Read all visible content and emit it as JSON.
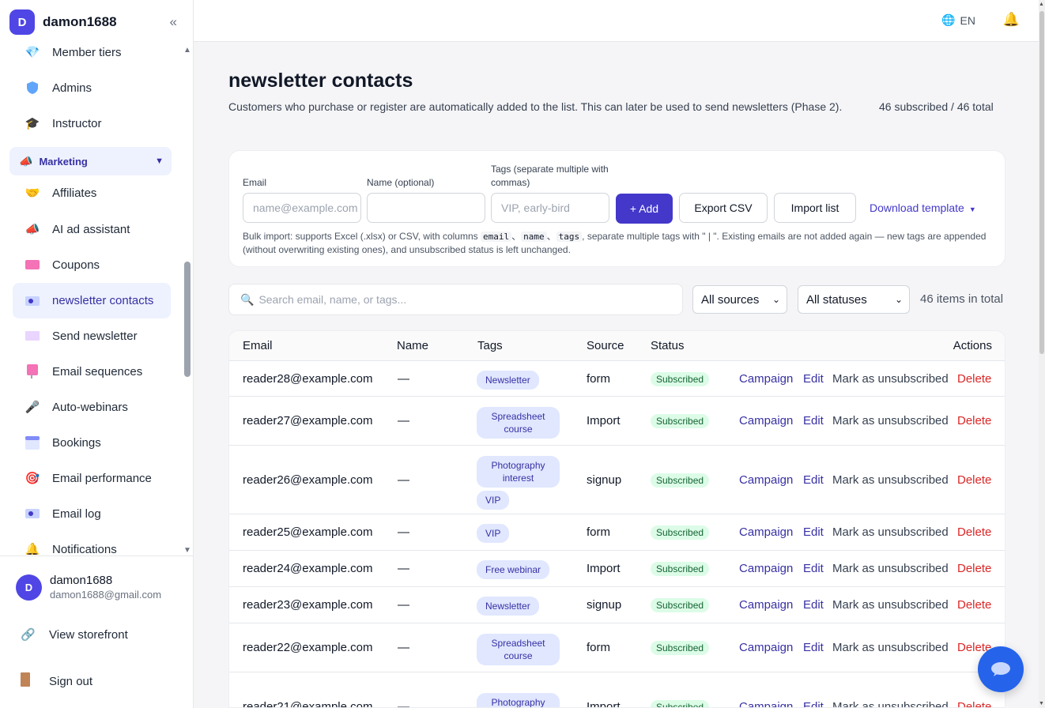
{
  "brand": {
    "initial": "D",
    "name": "damon1688"
  },
  "sidebar": {
    "items": [
      {
        "label": "Member tiers",
        "icon": "diamond-icon"
      },
      {
        "label": "Admins",
        "icon": "shield-icon"
      },
      {
        "label": "Instructor",
        "icon": "graduation-cap-icon"
      },
      {
        "label": "Marketing",
        "icon": "megaphone-icon"
      },
      {
        "label": "Affiliates",
        "icon": "handshake-icon"
      },
      {
        "label": "AI ad assistant",
        "icon": "megaphone-icon"
      },
      {
        "label": "Coupons",
        "icon": "ticket-icon"
      },
      {
        "label": "newsletter contacts",
        "icon": "contact-card-icon"
      },
      {
        "label": "Send newsletter",
        "icon": "envelope-icon"
      },
      {
        "label": "Email sequences",
        "icon": "sequence-icon"
      },
      {
        "label": "Auto-webinars",
        "icon": "webinar-icon"
      },
      {
        "label": "Bookings",
        "icon": "calendar-icon"
      },
      {
        "label": "Email performance",
        "icon": "target-icon"
      },
      {
        "label": "Email log",
        "icon": "log-icon"
      },
      {
        "label": "Notifications",
        "icon": "bell-icon"
      }
    ]
  },
  "user": {
    "initial": "D",
    "name": "damon1688",
    "email": "damon1688@gmail.com"
  },
  "footer": {
    "storefront": "View storefront",
    "signout": "Sign out"
  },
  "topbar": {
    "language": "EN"
  },
  "page": {
    "title": "newsletter contacts",
    "description": "Customers who purchase or register are automatically added to the list. This can later be used to send newsletters (Phase 2).",
    "summary": "46 subscribed / 46 total"
  },
  "form": {
    "email_label": "Email",
    "email_placeholder": "name@example.com",
    "name_label": "Name (optional)",
    "name_placeholder": "",
    "tags_label": "Tags (separate multiple with commas)",
    "tags_placeholder": "VIP, early-bird",
    "add_button": "+ Add",
    "export_button": "Export CSV",
    "import_button": "Import list",
    "download_template": "Download template",
    "help_prefix": "Bulk import: supports Excel (.xlsx) or CSV, with columns",
    "help_col_email": "email",
    "help_col_name": "name",
    "help_col_tags": "tags",
    "help_suffix": ", separate multiple tags with \" | \". Existing emails are not added again — new tags are appended (without overwriting existing ones), and unsubscribed status is left unchanged."
  },
  "filters": {
    "search_placeholder": "Search email, name, or tags...",
    "source_selected": "All sources",
    "status_selected": "All statuses",
    "items_total": "46 items in total"
  },
  "table": {
    "headers": {
      "email": "Email",
      "name": "Name",
      "tags": "Tags",
      "source": "Source",
      "status": "Status",
      "actions": "Actions"
    },
    "action_labels": {
      "campaign": "Campaign",
      "edit": "Edit",
      "unsubscribe": "Mark as unsubscribed",
      "delete": "Delete"
    },
    "rows": [
      {
        "email": "reader28@example.com",
        "name": "—",
        "tags": [
          "Newsletter"
        ],
        "source": "form",
        "status": "Subscribed"
      },
      {
        "email": "reader27@example.com",
        "name": "—",
        "tags": [
          "Spreadsheet course"
        ],
        "source": "Import",
        "status": "Subscribed"
      },
      {
        "email": "reader26@example.com",
        "name": "—",
        "tags": [
          "Photography interest",
          "VIP"
        ],
        "source": "signup",
        "status": "Subscribed"
      },
      {
        "email": "reader25@example.com",
        "name": "—",
        "tags": [
          "VIP"
        ],
        "source": "form",
        "status": "Subscribed"
      },
      {
        "email": "reader24@example.com",
        "name": "—",
        "tags": [
          "Free webinar"
        ],
        "source": "Import",
        "status": "Subscribed"
      },
      {
        "email": "reader23@example.com",
        "name": "—",
        "tags": [
          "Newsletter"
        ],
        "source": "signup",
        "status": "Subscribed"
      },
      {
        "email": "reader22@example.com",
        "name": "—",
        "tags": [
          "Spreadsheet course"
        ],
        "source": "form",
        "status": "Subscribed"
      },
      {
        "email": "reader21@example.com",
        "name": "—",
        "tags": [
          "Photography interest"
        ],
        "source": "Import",
        "status": "Subscribed"
      }
    ]
  }
}
